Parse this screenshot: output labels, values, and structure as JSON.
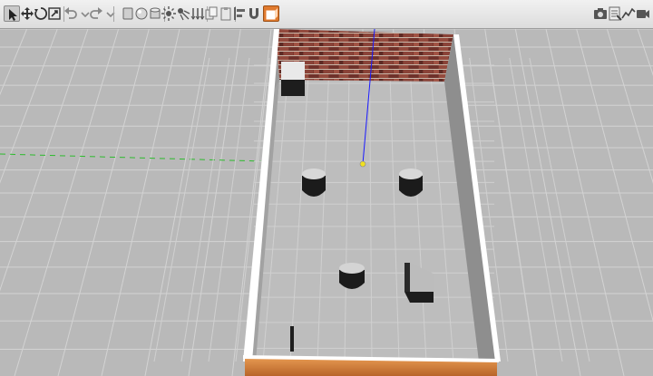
{
  "app": {
    "toolbar": {
      "left_tools": [
        {
          "id": "select-mode-button",
          "icon": "arrow-cursor-icon",
          "active": true
        },
        {
          "id": "translate-mode-button",
          "icon": "move-arrows-icon"
        },
        {
          "id": "rotate-mode-button",
          "icon": "rotate-icon"
        },
        {
          "id": "scale-mode-button",
          "icon": "scale-icon"
        },
        {
          "id": "undo-button",
          "icon": "undo-icon"
        },
        {
          "id": "undo-history-button",
          "icon": "chevron-down-icon"
        },
        {
          "id": "redo-button",
          "icon": "redo-icon"
        },
        {
          "id": "redo-history-button",
          "icon": "chevron-down-icon"
        },
        {
          "id": "insert-box-button",
          "icon": "box-icon"
        },
        {
          "id": "insert-sphere-button",
          "icon": "sphere-icon"
        },
        {
          "id": "insert-cylinder-button",
          "icon": "cylinder-icon"
        },
        {
          "id": "point-light-button",
          "icon": "point-light-icon"
        },
        {
          "id": "spot-light-button",
          "icon": "spot-light-icon"
        },
        {
          "id": "directional-light-button",
          "icon": "directional-light-icon"
        },
        {
          "id": "copy-button",
          "icon": "copy-icon"
        },
        {
          "id": "paste-button",
          "icon": "paste-icon"
        },
        {
          "id": "align-button",
          "icon": "align-icon"
        },
        {
          "id": "snap-button",
          "icon": "magnet-icon"
        },
        {
          "id": "change-view-button",
          "icon": "view-angle-icon",
          "active": true
        }
      ],
      "right_tools": [
        {
          "id": "screenshot-button",
          "icon": "camera-icon"
        },
        {
          "id": "log-button",
          "icon": "log-icon"
        },
        {
          "id": "plot-button",
          "icon": "plot-icon"
        },
        {
          "id": "video-record-button",
          "icon": "video-camera-icon"
        }
      ]
    },
    "viewport": {
      "ground_color": "#b9b9b9",
      "grid_color": "#d3d3d3",
      "wall_color": "#ffffff",
      "wall_shade_color": "#8e8e8e",
      "brick_color": "#7d3a32",
      "wood_color": "#cf7b3a",
      "x_axis_color": "#2dbb2d",
      "z_axis_color": "#1a1aff",
      "origin_marker_color": "#f0e020"
    }
  }
}
